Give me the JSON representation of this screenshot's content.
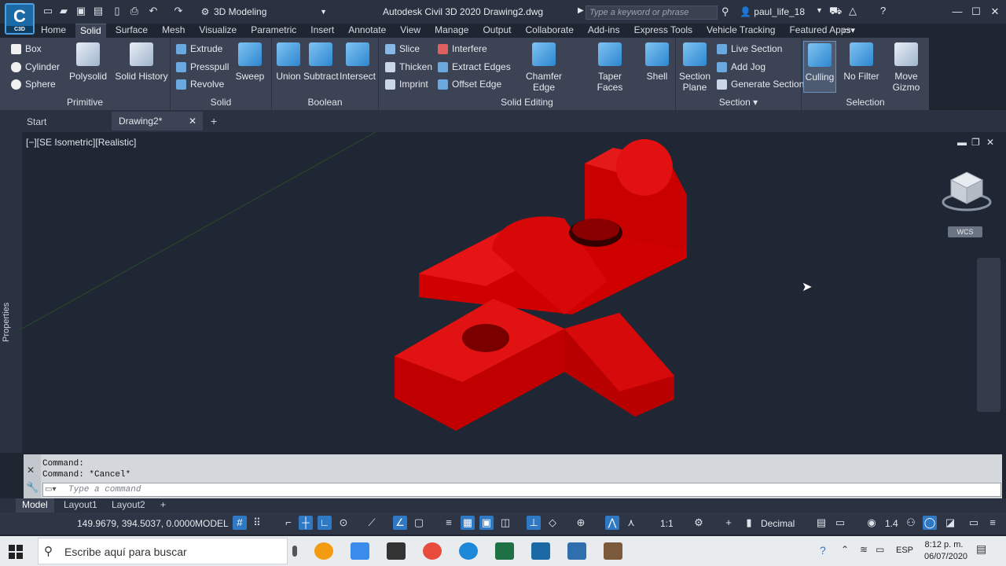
{
  "app": {
    "logo_text": "C",
    "logo_sub": "C3D",
    "workspace": "3D Modeling",
    "title": "Autodesk Civil 3D 2020   Drawing2.dwg",
    "search_placeholder": "Type a keyword or phrase",
    "user": "paul_life_18"
  },
  "ribbon_tabs": [
    "Home",
    "Solid",
    "Surface",
    "Mesh",
    "Visualize",
    "Parametric",
    "Insert",
    "Annotate",
    "View",
    "Manage",
    "Output",
    "Collaborate",
    "Add-ins",
    "Express Tools",
    "Vehicle Tracking",
    "Featured Apps"
  ],
  "panels": {
    "primitive": {
      "title": "Primitive",
      "box": "Box",
      "cylinder": "Cylinder",
      "sphere": "Sphere",
      "polysolid": "Polysolid",
      "solid_history": "Solid History"
    },
    "solid": {
      "title": "Solid",
      "extrude": "Extrude",
      "presspull": "Presspull",
      "revolve": "Revolve",
      "sweep": "Sweep"
    },
    "boolean": {
      "title": "Boolean",
      "union": "Union",
      "subtract": "Subtract",
      "intersect": "Intersect"
    },
    "solid_editing": {
      "title": "Solid Editing",
      "slice": "Slice",
      "thicken": "Thicken",
      "imprint": "Imprint",
      "interfere": "Interfere",
      "extract_edges": "Extract Edges",
      "offset_edge": "Offset Edge",
      "chamfer_edge": "Chamfer Edge",
      "taper_faces": "Taper Faces",
      "shell": "Shell"
    },
    "section": {
      "title": "Section",
      "section_plane": "Section Plane",
      "live_section": "Live Section",
      "add_jog": "Add Jog",
      "generate_section": "Generate Section"
    },
    "selection": {
      "title": "Selection",
      "culling": "Culling",
      "no_filter": "No Filter",
      "move_gizmo": "Move Gizmo"
    }
  },
  "doc_tabs": {
    "start": "Start",
    "drawing": "Drawing2*"
  },
  "viewport": {
    "label": "[−][SE Isometric][Realistic]",
    "wcs": "WCS",
    "properties": "Properties"
  },
  "command": {
    "line1": "Command:",
    "line2": "Command: *Cancel*",
    "placeholder": "Type a command"
  },
  "layout_tabs": [
    "Model",
    "Layout1",
    "Layout2"
  ],
  "status": {
    "coords": "149.9679, 394.5037, 0.0000",
    "model": "MODEL",
    "scale": "1:1",
    "units": "Decimal",
    "lineweight": "1.4"
  },
  "taskbar": {
    "search": "Escribe aquí para buscar",
    "lang": "ESP",
    "time": "8:12 p. m.",
    "date": "06/07/2020"
  },
  "colors": {
    "accent": "#2f78c4",
    "model_red": "#d40000",
    "ribbon": "#3b4354",
    "canvas": "#202734"
  }
}
